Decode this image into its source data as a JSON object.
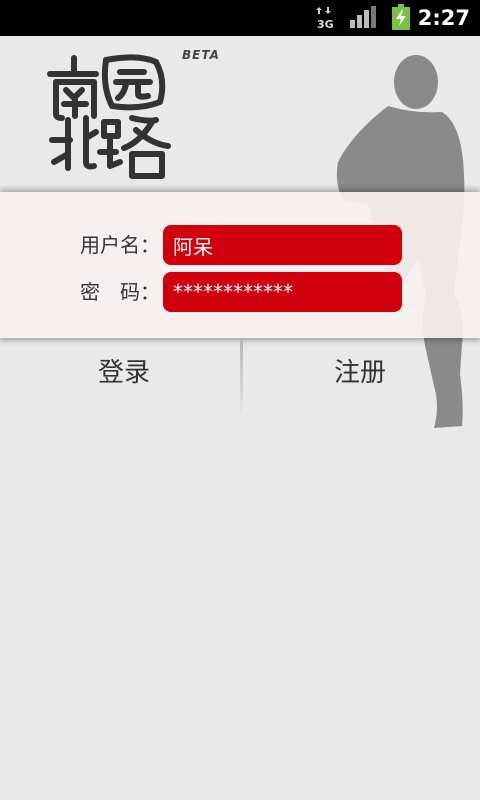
{
  "status_bar": {
    "network": "3G",
    "time": "2:27",
    "icons": [
      "data-arrows-icon",
      "signal-strength-icon",
      "battery-charging-icon"
    ]
  },
  "logo": {
    "beta_label": "BETA"
  },
  "form": {
    "username_label": "用户名：",
    "username_value": "阿呆",
    "password_label": "密　码：",
    "password_value": "************"
  },
  "buttons": {
    "login_label": "登录",
    "register_label": "注册"
  },
  "colors": {
    "field_background": "#d0000c",
    "page_background": "#e9e9e9",
    "status_bar": "#000000",
    "battery": "#7ac143"
  }
}
